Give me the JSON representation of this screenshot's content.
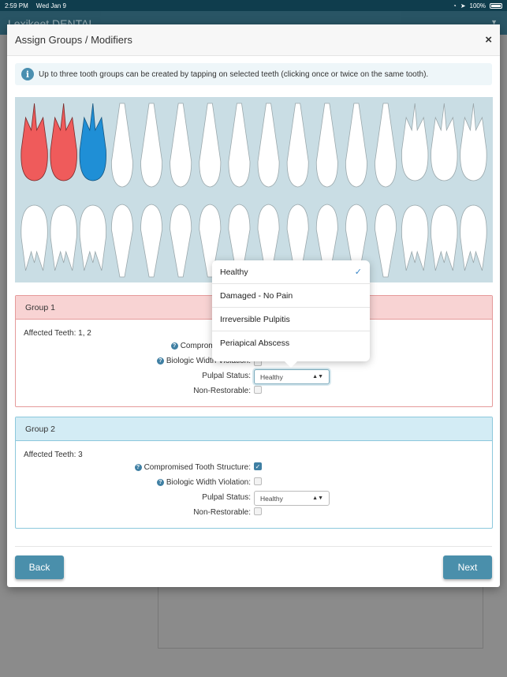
{
  "status_bar": {
    "time": "2:59 PM",
    "date": "Wed Jan 9",
    "battery": "100%"
  },
  "app": {
    "title": "Lexikeet DENTAL"
  },
  "modal": {
    "title": "Assign Groups / Modifiers",
    "close": "×",
    "info": "Up to three tooth groups can be created by tapping on selected teeth (clicking once or twice on the same tooth)."
  },
  "teeth": {
    "upper_count": 16,
    "lower_count": 16,
    "selected": [
      {
        "tooth": 1,
        "group": 1,
        "color": "#ef5b5b"
      },
      {
        "tooth": 2,
        "group": 1,
        "color": "#ef5b5b"
      },
      {
        "tooth": 3,
        "group": 2,
        "color": "#1f8fd6"
      }
    ]
  },
  "labels": {
    "compromised": "Compromised Tooth Structure:",
    "biologic": "Biologic Width Violation:",
    "pulpal": "Pulpal Status:",
    "non_restorable": "Non-Restorable:"
  },
  "groups": [
    {
      "title": "Group 1",
      "affected": "Affected Teeth: 1, 2",
      "compromised_visible": "Compromised Tooth",
      "biologic_visible": "Biologic Width Violation:",
      "pulpal_status": "Healthy",
      "compromised_checked": false,
      "biologic_checked": false,
      "non_restorable_checked": false
    },
    {
      "title": "Group 2",
      "affected": "Affected Teeth: 3",
      "pulpal_status": "Healthy",
      "compromised_checked": true,
      "biologic_checked": false,
      "non_restorable_checked": false
    }
  ],
  "popover": {
    "options": [
      "Healthy",
      "Damaged - No Pain",
      "Irreversible Pulpitis",
      "Periapical Abscess"
    ],
    "selected": "Healthy"
  },
  "buttons": {
    "back": "Back",
    "next": "Next"
  }
}
